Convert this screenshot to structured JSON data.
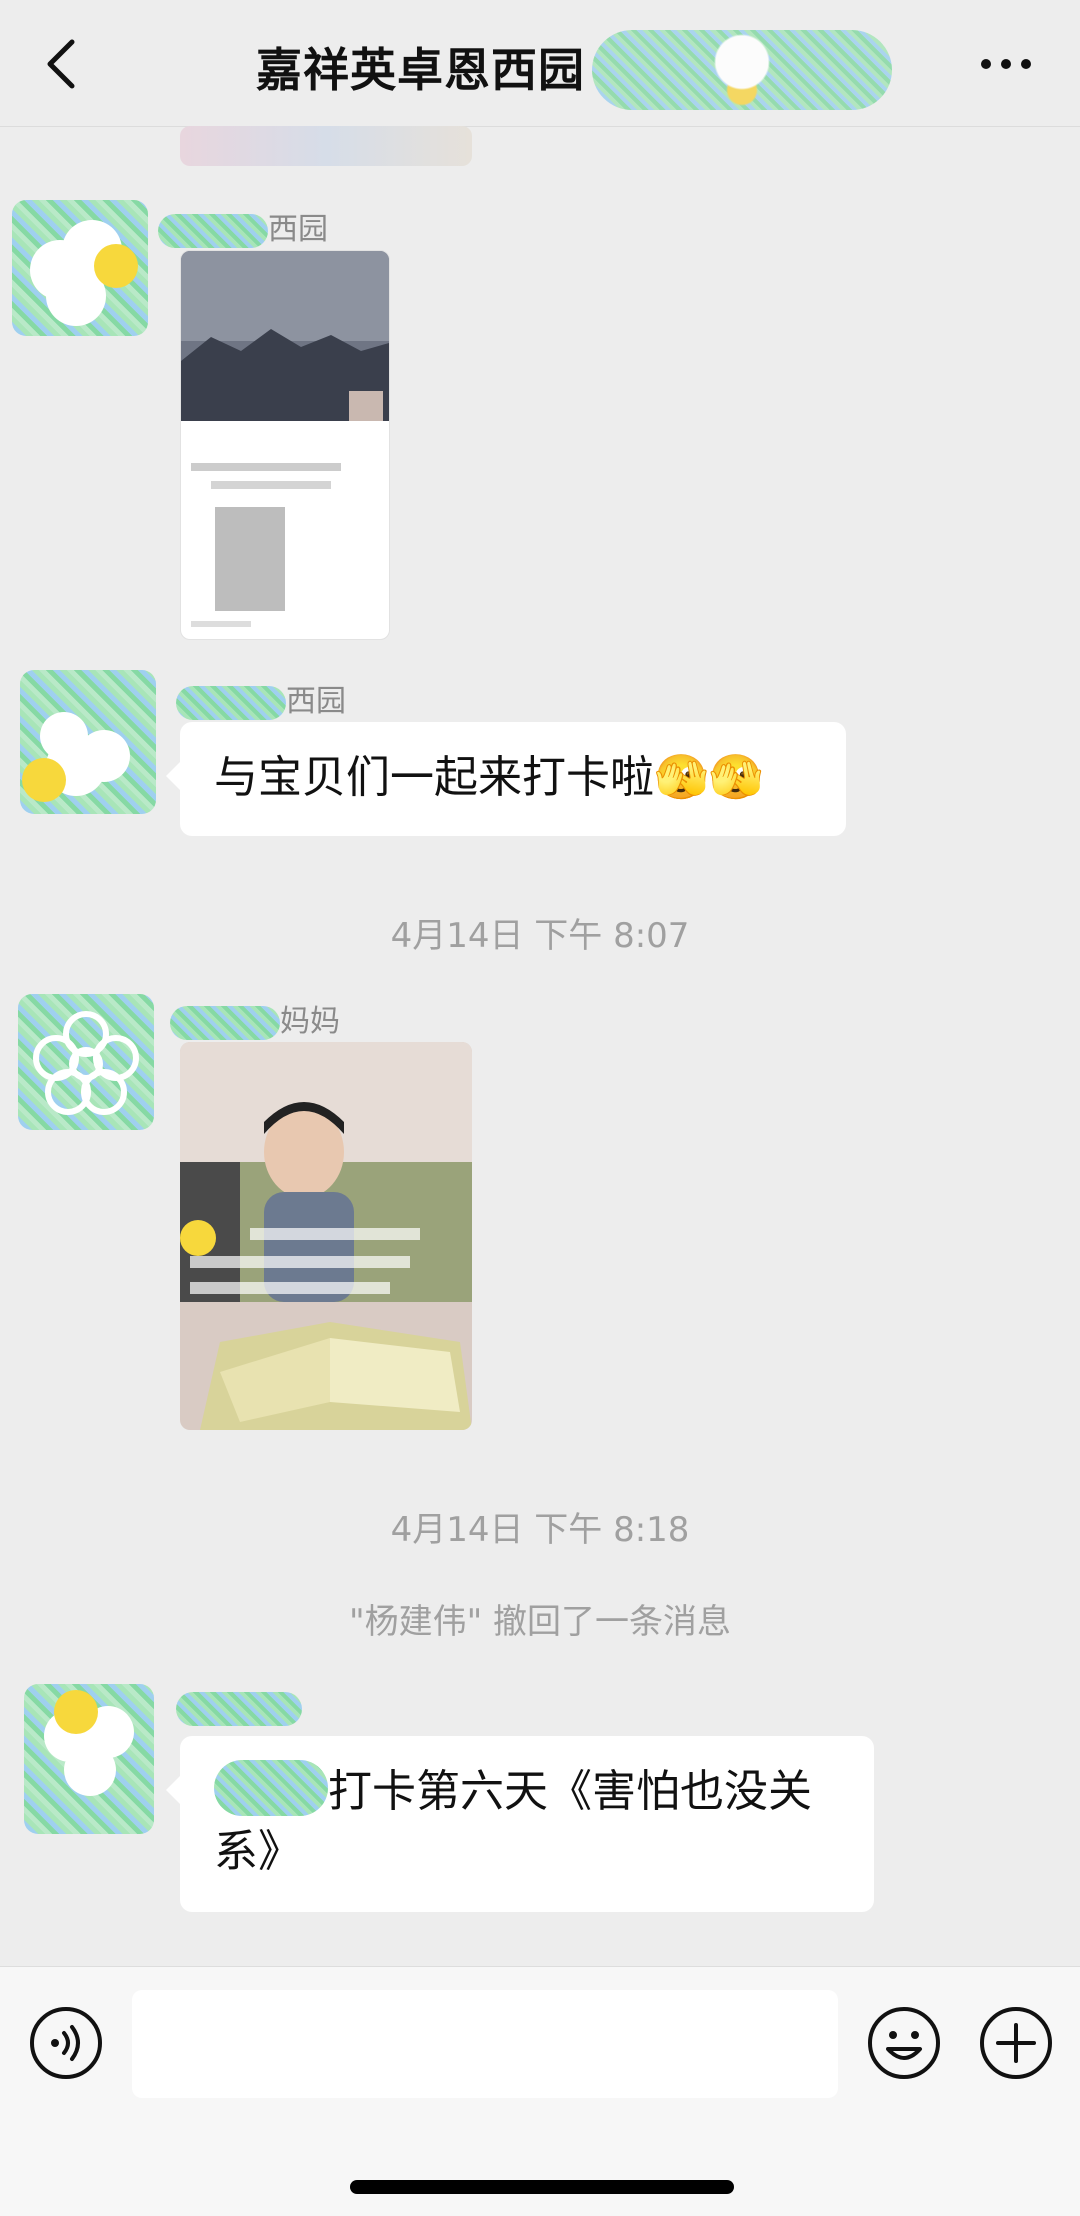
{
  "header": {
    "title": "嘉祥英卓恩西园",
    "back_icon": "chevron-left-icon",
    "more_icon": "more-dots-icon"
  },
  "messages": [
    {
      "sender_suffix": "西园",
      "type": "image",
      "image_desc": "screenshot"
    },
    {
      "sender_suffix": "西园",
      "type": "text",
      "text": "与宝贝们一起来打卡啦",
      "emoji": "🫣🫣"
    },
    {
      "sender_suffix": "妈妈",
      "type": "image",
      "image_desc": "photo"
    },
    {
      "sender_suffix": "",
      "type": "text",
      "text_visible": "打卡第六天《害怕也没关系》"
    }
  ],
  "timestamps": [
    "4月14日 下午 8:07",
    "4月14日 下午 8:18"
  ],
  "system_notice": "\"杨建伟\" 撤回了一条消息",
  "input_bar": {
    "voice_icon": "voice-icon",
    "emoji_icon": "emoji-icon",
    "plus_icon": "plus-icon",
    "placeholder": ""
  },
  "colors": {
    "background": "#ededed",
    "bubble": "#ffffff",
    "meta_text": "#a0a0a0"
  }
}
